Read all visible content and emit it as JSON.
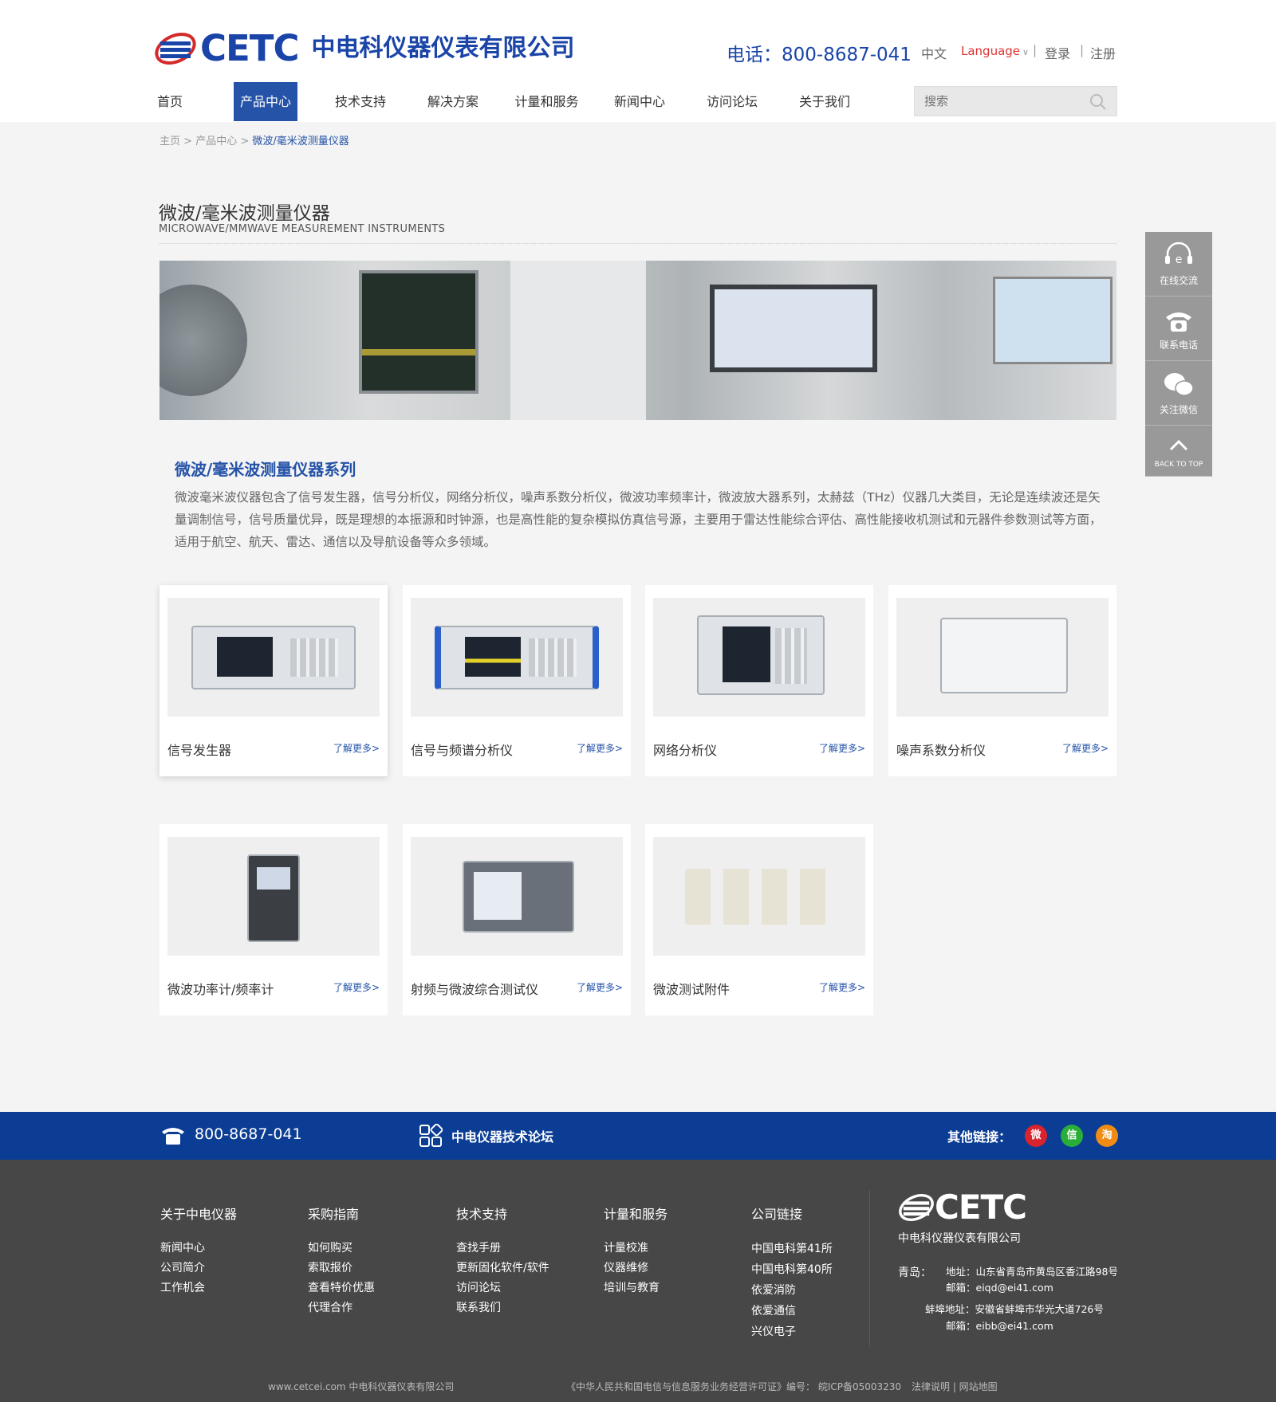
{
  "brand": {
    "logo_text": "CETC",
    "company": "中电科仪器仪表有限公司"
  },
  "header": {
    "phone": "电话：800-8687-041",
    "lang_cn": "中文",
    "language": "Language",
    "login": "登录",
    "register": "注册",
    "sep": "|"
  },
  "nav": [
    {
      "label": "首页",
      "active": false
    },
    {
      "label": "产品中心",
      "active": true
    },
    {
      "label": "技术支持",
      "active": false
    },
    {
      "label": "解决方案",
      "active": false
    },
    {
      "label": "计量和服务",
      "active": false
    },
    {
      "label": "新闻中心",
      "active": false
    },
    {
      "label": "访问论坛",
      "active": false
    },
    {
      "label": "关于我们",
      "active": false
    }
  ],
  "search": {
    "placeholder": "搜索"
  },
  "breadcrumb": {
    "home": "主页",
    "sep": ">",
    "category": "产品中心",
    "current": "微波/毫米波测量仪器"
  },
  "page": {
    "title": "微波/毫米波测量仪器",
    "subtitle": "MICROWAVE/MMWAVE MEASUREMENT INSTRUMENTS"
  },
  "section": {
    "title": "微波/毫米波测量仪器系列",
    "description": "微波毫米波仪器包含了信号发生器，信号分析仪，网络分析仪，噪声系数分析仪，微波功率频率计，微波放大器系列，太赫兹（THz）仪器几大类目，无论是连续波还是矢量调制信号，信号质量优异，既是理想的本振源和时钟源，也是高性能的复杂模拟仿真信号源，主要用于雷达性能综合评估、高性能接收机测试和元器件参数测试等方面，适用于航空、航天、雷达、通信以及导航设备等众多领域。"
  },
  "products": [
    {
      "name": "信号发生器",
      "more": "了解更多>"
    },
    {
      "name": "信号与频谱分析仪",
      "more": "了解更多>"
    },
    {
      "name": "网络分析仪",
      "more": "了解更多>"
    },
    {
      "name": "噪声系数分析仪",
      "more": "了解更多>"
    },
    {
      "name": "微波功率计/频率计",
      "more": "了解更多>"
    },
    {
      "name": "射频与微波综合测试仪",
      "more": "了解更多>"
    },
    {
      "name": "微波测试附件",
      "more": "了解更多>"
    }
  ],
  "sidebar": {
    "chat": "在线交流",
    "phone": "联系电话",
    "wechat": "关注微信",
    "top": "BACK TO TOP"
  },
  "bluebar": {
    "phone": "800-8687-041",
    "forum": "中电仪器技术论坛",
    "other": "其他链接：",
    "weibo": "微",
    "wechat": "信",
    "taobao": "淘"
  },
  "footer": {
    "cols": [
      {
        "title": "关于中电仪器",
        "links": [
          "新闻中心",
          "公司简介",
          "工作机会"
        ]
      },
      {
        "title": "采购指南",
        "links": [
          "如何购买",
          "索取报价",
          "查看特价优惠",
          "代理合作"
        ]
      },
      {
        "title": "技术支持",
        "links": [
          "查找手册",
          "更新固化软件/软件",
          "访问论坛",
          "联系我们"
        ]
      },
      {
        "title": "计量和服务",
        "links": [
          "计量校准",
          "仪器维修",
          "培训与教育"
        ]
      },
      {
        "title": "公司链接",
        "links": [
          "中国电科第41所",
          "中国电科第40所",
          "依爱消防",
          "依爱通信",
          "兴仪电子"
        ]
      }
    ],
    "logo_text": "CETC",
    "company": "中电科仪器仪表有限公司",
    "qingdao_label": "青岛：",
    "qingdao_addr": "地址：山东省青岛市黄岛区香江路98号",
    "qingdao_mail": "邮箱：eiqd@ei41.com",
    "bengbu_addr": "蚌埠地址：安徽省蚌埠市华光大道726号",
    "bengbu_mail": "邮箱：eibb@ei41.com",
    "site": "www.cetcei.com  中电科仪器仪表有限公司",
    "license": "《中华人民共和国电信与信息服务业务经营许可证》编号： 皖ICP备05003230",
    "legal": "法律说明 |  网站地图"
  },
  "colors": {
    "brand_blue": "#2553a8",
    "bar_blue": "#0c3d94",
    "footer": "#474747",
    "accent_red": "#d33"
  }
}
